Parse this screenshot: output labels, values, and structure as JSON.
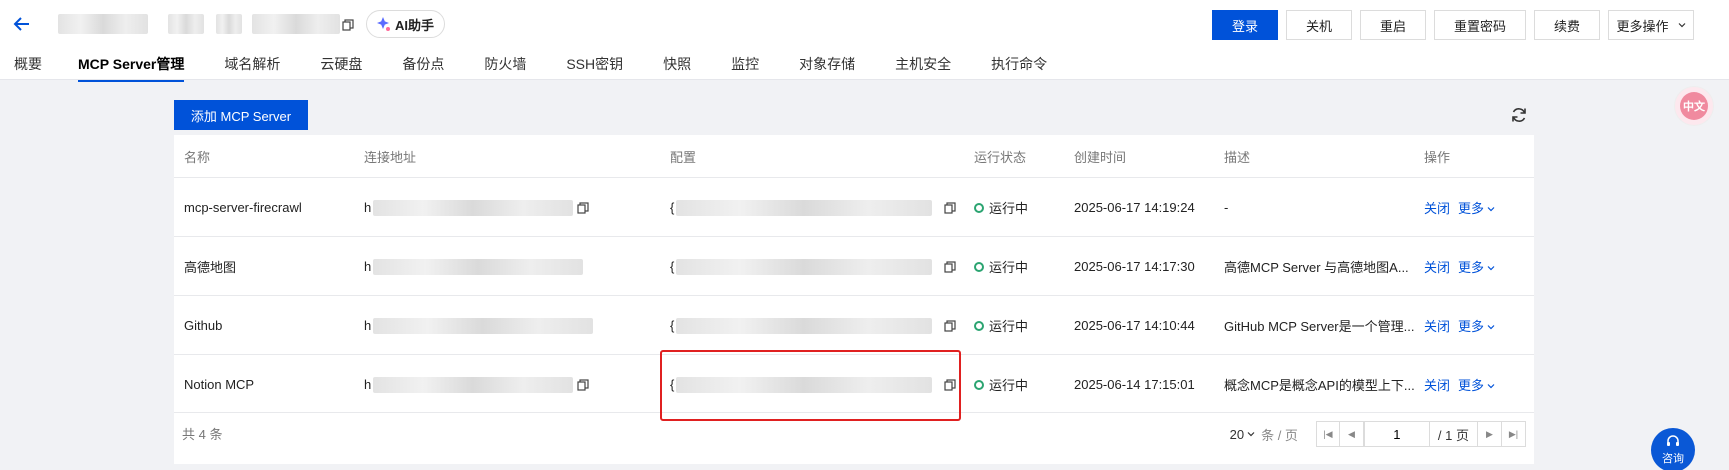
{
  "header": {
    "ai_label": "AI助手",
    "actions": [
      "登录",
      "关机",
      "重启",
      "重置密码",
      "续费"
    ],
    "more_label": "更多操作"
  },
  "tabs": [
    "概要",
    "MCP Server管理",
    "域名解析",
    "云硬盘",
    "备份点",
    "防火墙",
    "SSH密钥",
    "快照",
    "监控",
    "对象存储",
    "主机安全",
    "执行命令"
  ],
  "active_tab": "MCP Server管理",
  "toolbar": {
    "add_label": "添加 MCP Server"
  },
  "table": {
    "columns": [
      "名称",
      "连接地址",
      "配置",
      "运行状态",
      "创建时间",
      "描述",
      "操作"
    ],
    "rows": [
      {
        "name": "mcp-server-firecrawl",
        "address_prefix": "h",
        "config_prefix": "{",
        "status": "运行中",
        "created": "2025-06-17 14:19:24",
        "desc": "-",
        "op_close": "关闭",
        "op_more": "更多"
      },
      {
        "name": "高德地图",
        "address_prefix": "h",
        "config_prefix": "{",
        "status": "运行中",
        "created": "2025-06-17 14:17:30",
        "desc": "高德MCP Server 与高德地图A...",
        "op_close": "关闭",
        "op_more": "更多"
      },
      {
        "name": "Github",
        "address_prefix": "h",
        "config_prefix": "{",
        "status": "运行中",
        "created": "2025-06-17 14:10:44",
        "desc": "GitHub MCP Server是一个管理...",
        "op_close": "关闭",
        "op_more": "更多"
      },
      {
        "name": "Notion MCP",
        "address_prefix": "h",
        "config_prefix": "{",
        "status": "运行中",
        "created": "2025-06-14 17:15:01",
        "desc": "概念MCP是概念API的模型上下...",
        "op_close": "关闭",
        "op_more": "更多"
      }
    ]
  },
  "pagination": {
    "total": "共 4 条",
    "page_size": "20",
    "per_page_unit": "条 / 页",
    "current_page": "1",
    "total_pages": "/ 1 页"
  },
  "floating": {
    "consult_label": "咨询",
    "translate_label": "中文"
  },
  "colors": {
    "primary": "#0052d9",
    "running": "#2ba471",
    "highlight": "#e02020"
  }
}
